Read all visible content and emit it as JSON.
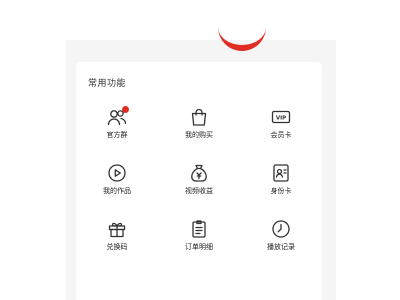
{
  "section": {
    "title": "常用功能"
  },
  "items": [
    {
      "label": "官方群",
      "icon": "group-chat-icon"
    },
    {
      "label": "我的购买",
      "icon": "shopping-bag-icon"
    },
    {
      "label": "会员卡",
      "icon": "vip-card-icon"
    },
    {
      "label": "我的作品",
      "icon": "play-circle-icon"
    },
    {
      "label": "视频收益",
      "icon": "money-bag-icon"
    },
    {
      "label": "身份卡",
      "icon": "id-card-icon"
    },
    {
      "label": "兑换码",
      "icon": "gift-icon"
    },
    {
      "label": "订单明细",
      "icon": "order-list-icon"
    },
    {
      "label": "播放记录",
      "icon": "clock-icon"
    }
  ],
  "vip_badge_text": "VIP",
  "colors": {
    "accent": "#e02e24",
    "icon_stroke": "#333333",
    "background": "#f5f5f5",
    "card": "#ffffff"
  }
}
